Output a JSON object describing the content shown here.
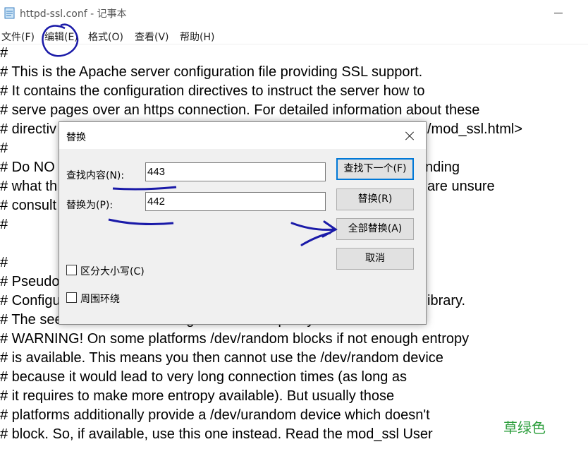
{
  "window": {
    "title": "httpd-ssl.conf - 记事本"
  },
  "menu": [
    "文件(F)",
    "编辑(E)",
    "格式(O)",
    "查看(V)",
    "帮助(H)"
  ],
  "editor_lines": [
    "#",
    "# This is the Apache server configuration file providing SSL support.",
    "# It contains the configuration directives to instruct the server how to",
    "# serve pages over an https connection. For detailed information about these",
    "# directiv",
    "/mod_ssl.html>",
    "#",
    "# Do NO",
    "nding",
    "# what th",
    "are unsure",
    "# consult",
    "#",
    "#",
    "# Pseudo",
    "# Configu",
    "ibrary.",
    "# The seed data should be of good random quality.",
    "# WARNING! On some platforms /dev/random blocks if not enough entropy",
    "# is available. This means you then cannot use the /dev/random device",
    "# because it would lead to very long connection times (as long as",
    "# it requires to make more entropy available). But usually those",
    "# platforms additionally provide a /dev/urandom device which doesn't",
    "# block. So, if available, use this one instead. Read the mod_ssl User"
  ],
  "dialog": {
    "title": "替换",
    "find_label": "查找内容(N):",
    "find_value": "443",
    "replace_label": "替换为(P):",
    "replace_value": "442",
    "match_case_label": "区分大小写(C)",
    "wrap_label": "周围环绕",
    "buttons": {
      "find_next": "查找下一个(F)",
      "replace": "替换(R)",
      "replace_all": "全部替换(A)",
      "cancel": "取消"
    }
  },
  "watermark": "草绿色",
  "colors": {
    "accent": "#0078d7",
    "annotation": "#1a1aa8",
    "watermark": "#2a9d3a"
  }
}
